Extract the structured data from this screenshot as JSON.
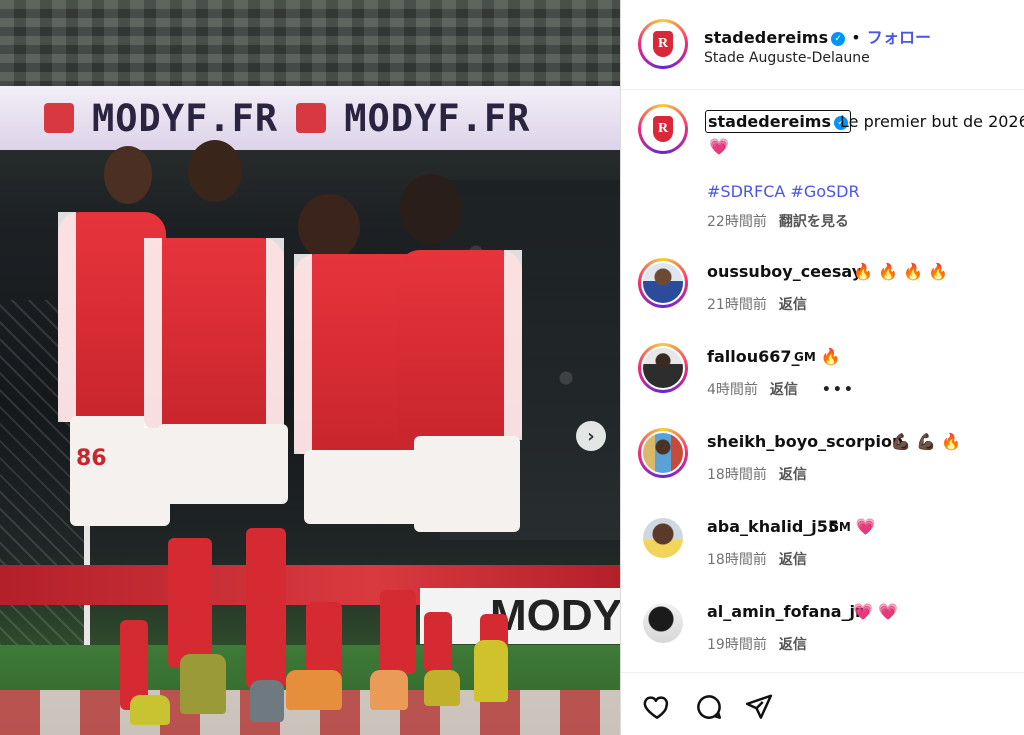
{
  "photo": {
    "banner_text_1": "MODYF.FR",
    "banner_text_2": "MODYF.FR",
    "board_text": "MODY",
    "jersey_number": "86",
    "next_icon": "chevron-right-icon"
  },
  "header": {
    "username": "stadedereims",
    "verified_icon": "verified-badge-icon",
    "separator": "•",
    "follow_label": "フォロー",
    "location": "Stade Auguste-Delaune"
  },
  "caption": {
    "username": "stadedereims",
    "text": "Le premier but de 2026",
    "emoji": "💗",
    "hashtags": "#SDRFCA #GoSDR",
    "time": "22時間前",
    "translate_label": "翻訳を見る"
  },
  "comments": [
    {
      "username": "oussuboy_ceesay",
      "text": "🔥 🔥 🔥 🔥",
      "time": "21時間前",
      "reply": "返信"
    },
    {
      "username": "fallou667_",
      "gm": "GM",
      "text": "🔥",
      "time": "4時間前",
      "reply": "返信",
      "more": "•••"
    },
    {
      "username": "sheikh_boyo_scorpion",
      "text": "💪🏿 💪🏿 🔥",
      "time": "18時間前",
      "reply": "返信"
    },
    {
      "username": "aba_khalid_j55",
      "gm": "GM",
      "text": "💗",
      "time": "18時間前",
      "reply": "返信"
    },
    {
      "username": "al_amin_fofana_jr",
      "text": "💗 💗",
      "time": "19時間前",
      "reply": "返信"
    }
  ],
  "actions": {
    "like_icon": "heart-outline-icon",
    "comment_icon": "comment-bubble-icon",
    "share_icon": "paper-plane-icon"
  },
  "colors": {
    "accent_link": "#4b55e6",
    "verified": "#0095f6",
    "muted": "#737373",
    "club_red": "#d8283a"
  }
}
